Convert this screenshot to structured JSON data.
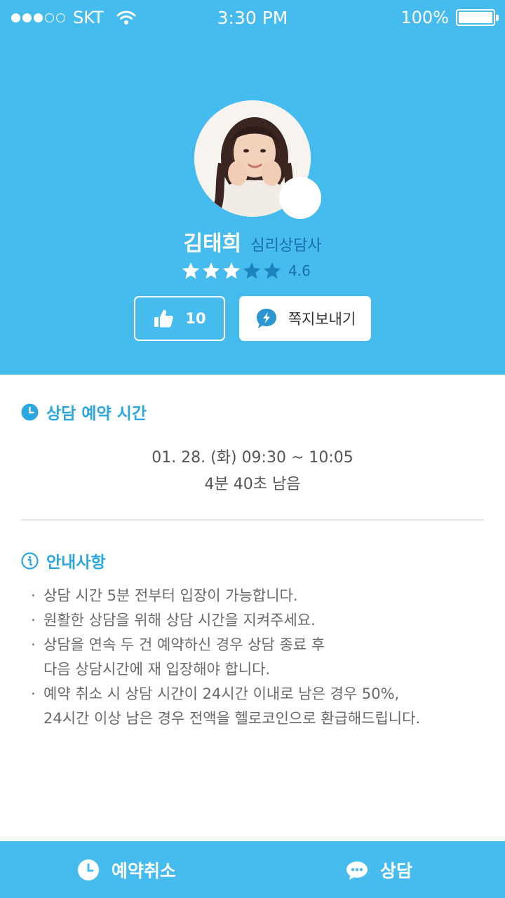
{
  "status_bar": {
    "signal_dots": [
      "full",
      "full",
      "full",
      "empty",
      "empty"
    ],
    "carrier": "SKT",
    "time": "3:30 PM",
    "battery": "100%"
  },
  "profile": {
    "name": "김태희",
    "role": "심리상담사",
    "rating": {
      "value": "4.6",
      "stars_filled": 3,
      "stars_total": 5
    },
    "likes": "10",
    "message_button": "쪽지보내기"
  },
  "reservation": {
    "title": "상담 예약 시간",
    "time": "01. 28. (화) 09:30 ~ 10:05",
    "remaining": "4분 40초 남음"
  },
  "notice": {
    "title": "안내사항",
    "items": [
      "상담 시간 5분 전부터 입장이 가능합니다.",
      "원활한 상담을 위해 상담 시간을 지켜주세요.",
      "상담을 연속 두 건 예약하신 경우 상담 종료 후\n다음 상담시간에 재 입장해야 합니다.",
      "예약 취소 시 상담 시간이 24시간 이내로 남은 경우 50%,\n24시간 이상 남은 경우 전액을 헬로코인으로 환급해드립니다."
    ]
  },
  "bottom_bar": {
    "cancel_label": "예약취소",
    "consult_label": "상담"
  },
  "colors": {
    "primary": "#46bbee",
    "accent_text": "#2aa7e0",
    "star_dark": "#1b83bf"
  }
}
